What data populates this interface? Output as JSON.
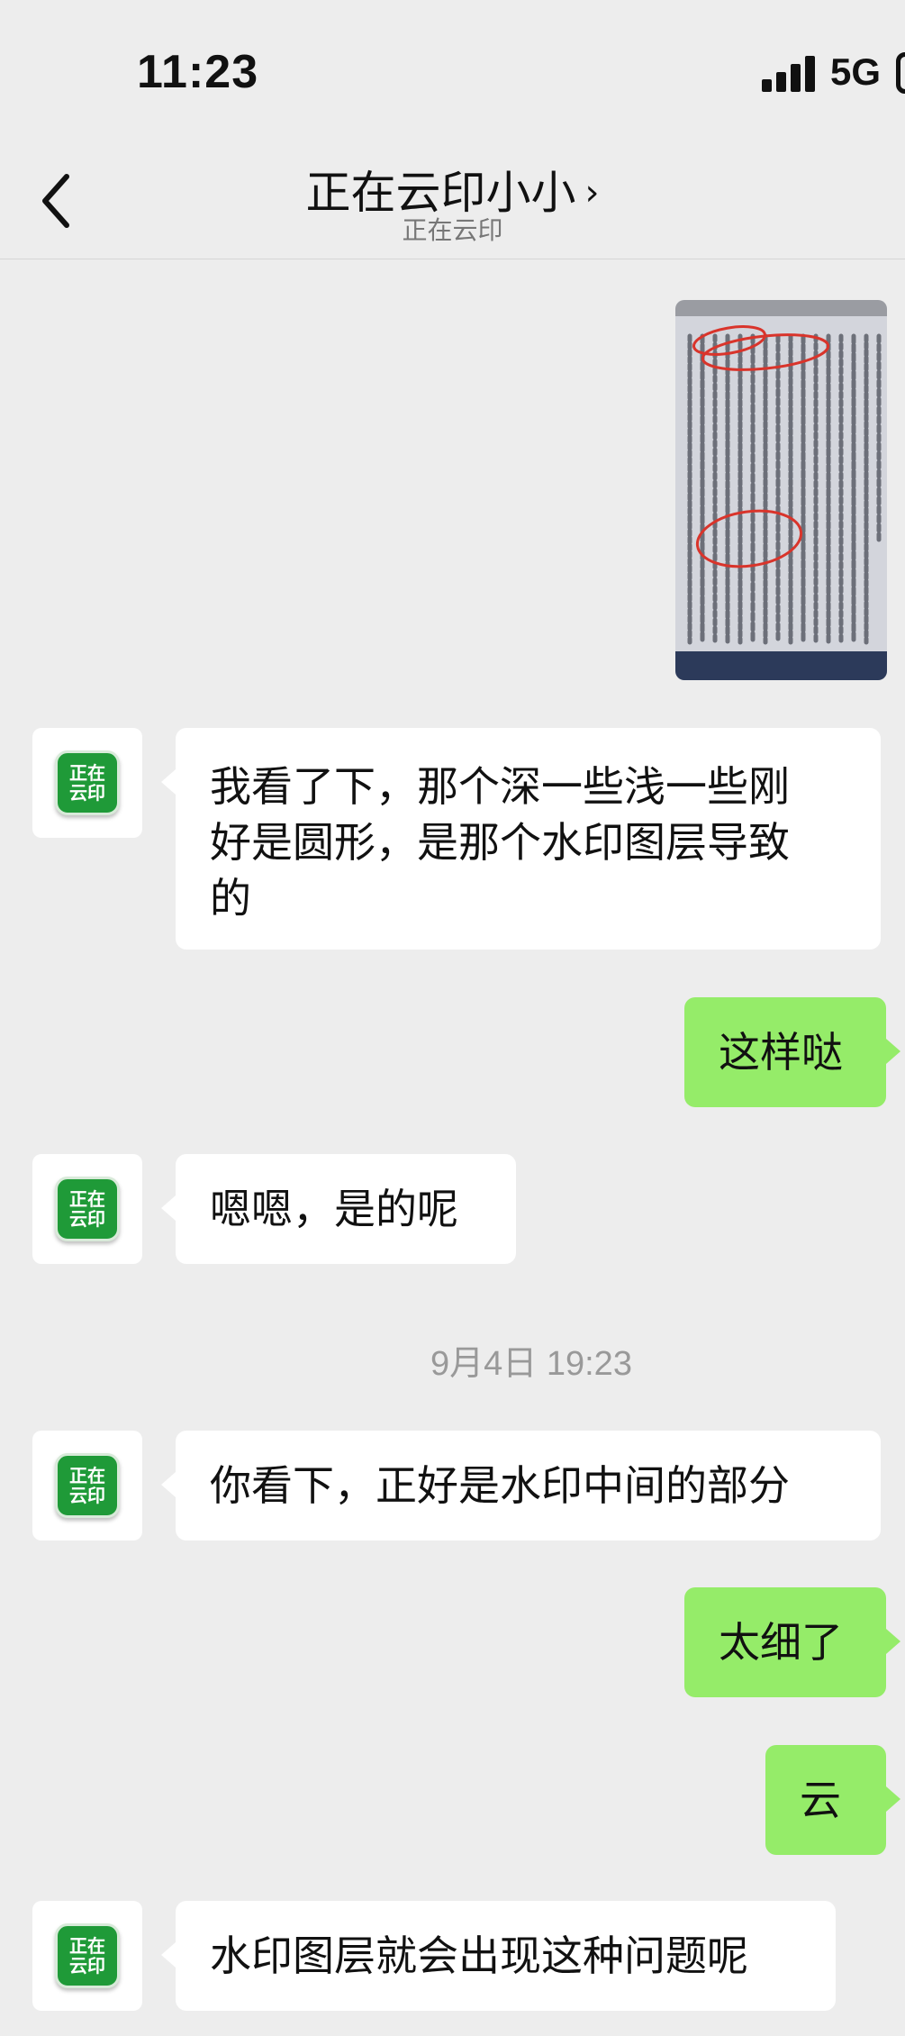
{
  "status_bar": {
    "time": "11:23",
    "network": "5G"
  },
  "header": {
    "title": "正在云印小小",
    "subtitle": "正在云印"
  },
  "avatar_text": {
    "line1": "正在",
    "line2": "云印"
  },
  "messages": [
    {
      "side": "out",
      "kind": "image",
      "icon": "document-photo"
    },
    {
      "side": "in",
      "text": "我看了下，那个深一些浅一些刚好是圆形，是那个水印图层导致的",
      "lines": [
        "我看了下，那个深一些浅一些刚",
        "好是圆形，是那个水印图层导致",
        "的"
      ]
    },
    {
      "side": "out",
      "text": "这样哒"
    },
    {
      "side": "in",
      "text": "嗯嗯，是的呢"
    },
    {
      "side": "in",
      "text": "你看下，正好是水印中间的部分"
    },
    {
      "side": "out",
      "text": "太细了"
    },
    {
      "side": "out",
      "text": "云"
    },
    {
      "side": "in",
      "text": "水印图层就会出现这种问题呢"
    }
  ],
  "timestamp": "9月4日 19:23",
  "colors": {
    "background": "#ededed",
    "outgoing_bubble": "#95ec69",
    "incoming_bubble": "#ffffff",
    "avatar_green": "#1f9a38"
  }
}
